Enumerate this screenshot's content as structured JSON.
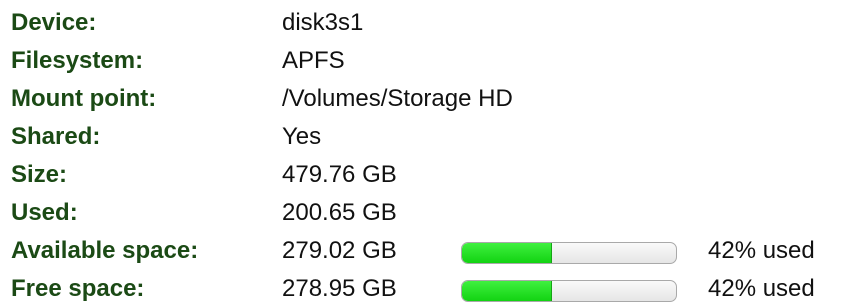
{
  "colors": {
    "label": "#1b4a15",
    "value": "#111111",
    "bar_fill": "#14dc14",
    "bar_track": "#f0f0f0"
  },
  "rows": [
    {
      "label": "Device:",
      "value": "disk3s1"
    },
    {
      "label": "Filesystem:",
      "value": "APFS"
    },
    {
      "label": "Mount point:",
      "value": "/Volumes/Storage HD"
    },
    {
      "label": "Shared:",
      "value": "Yes"
    },
    {
      "label": "Size:",
      "value": "479.76 GB"
    },
    {
      "label": "Used:",
      "value": "200.65 GB"
    },
    {
      "label": "Available space:",
      "value": "279.02 GB",
      "usage_fraction": 0.42,
      "usage_text": "42% used"
    },
    {
      "label": "Free space:",
      "value": "278.95 GB",
      "usage_fraction": 0.42,
      "usage_text": "42% used"
    }
  ]
}
